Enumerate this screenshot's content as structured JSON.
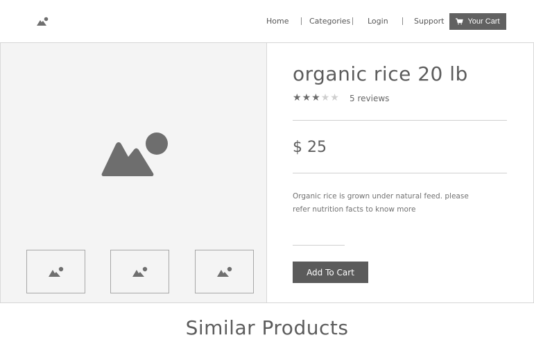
{
  "header": {
    "logo_icon": "image-icon",
    "nav": [
      {
        "label": "Home"
      },
      {
        "label": "Categories"
      },
      {
        "label": "Login"
      },
      {
        "label": "Support"
      }
    ],
    "cart_label": "Your Cart",
    "cart_icon": "cart-icon"
  },
  "gallery": {
    "main_image_icon": "image-icon",
    "thumbnail_icons": [
      "image-icon",
      "image-icon",
      "image-icon"
    ]
  },
  "product": {
    "title": "organic rice 20 lb",
    "rating": {
      "value": 3,
      "max": 5
    },
    "reviews": "5 reviews",
    "price": "$ 25",
    "description": "Organic rice is grown under natural feed. please refer nutrition facts to know more",
    "add_to_cart_label": "Add To Cart"
  },
  "similar": {
    "title": "Similar Products"
  },
  "colors": {
    "button_dark": "#5b5b5b",
    "gallery_bg": "#f4f4f4",
    "text": "#5f5f5f"
  }
}
